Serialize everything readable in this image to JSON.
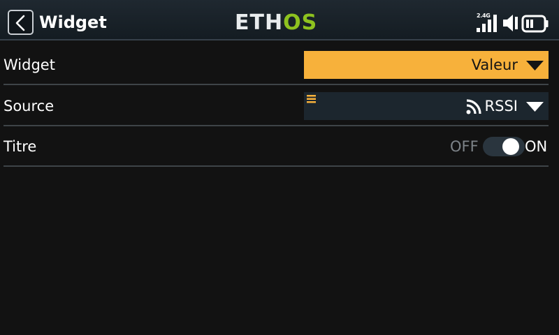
{
  "header": {
    "title": "Widget",
    "back_icon": "chevron-left-icon",
    "logo_left": "ETH",
    "logo_right": "OS",
    "logo_colors": {
      "eth": "#e9ecee",
      "os": "#8ec21f"
    },
    "status": {
      "band": "2.4G",
      "signal_icon": "signal-bars-icon",
      "speaker_icon": "speaker-icon",
      "battery_icon": "battery-icon"
    }
  },
  "settings": [
    {
      "label": "Widget",
      "value": "Valeur",
      "style": "orange"
    },
    {
      "label": "Source",
      "value": "RSSI",
      "icon": "rss-icon",
      "menu_icon": "menu-icon"
    },
    {
      "label": "Titre",
      "toggle": {
        "off_label": "OFF",
        "on_label": "ON",
        "state": "on"
      }
    }
  ],
  "colors": {
    "accent": "#f7b13b",
    "background": "#121212",
    "field_dark": "#1c262e"
  }
}
